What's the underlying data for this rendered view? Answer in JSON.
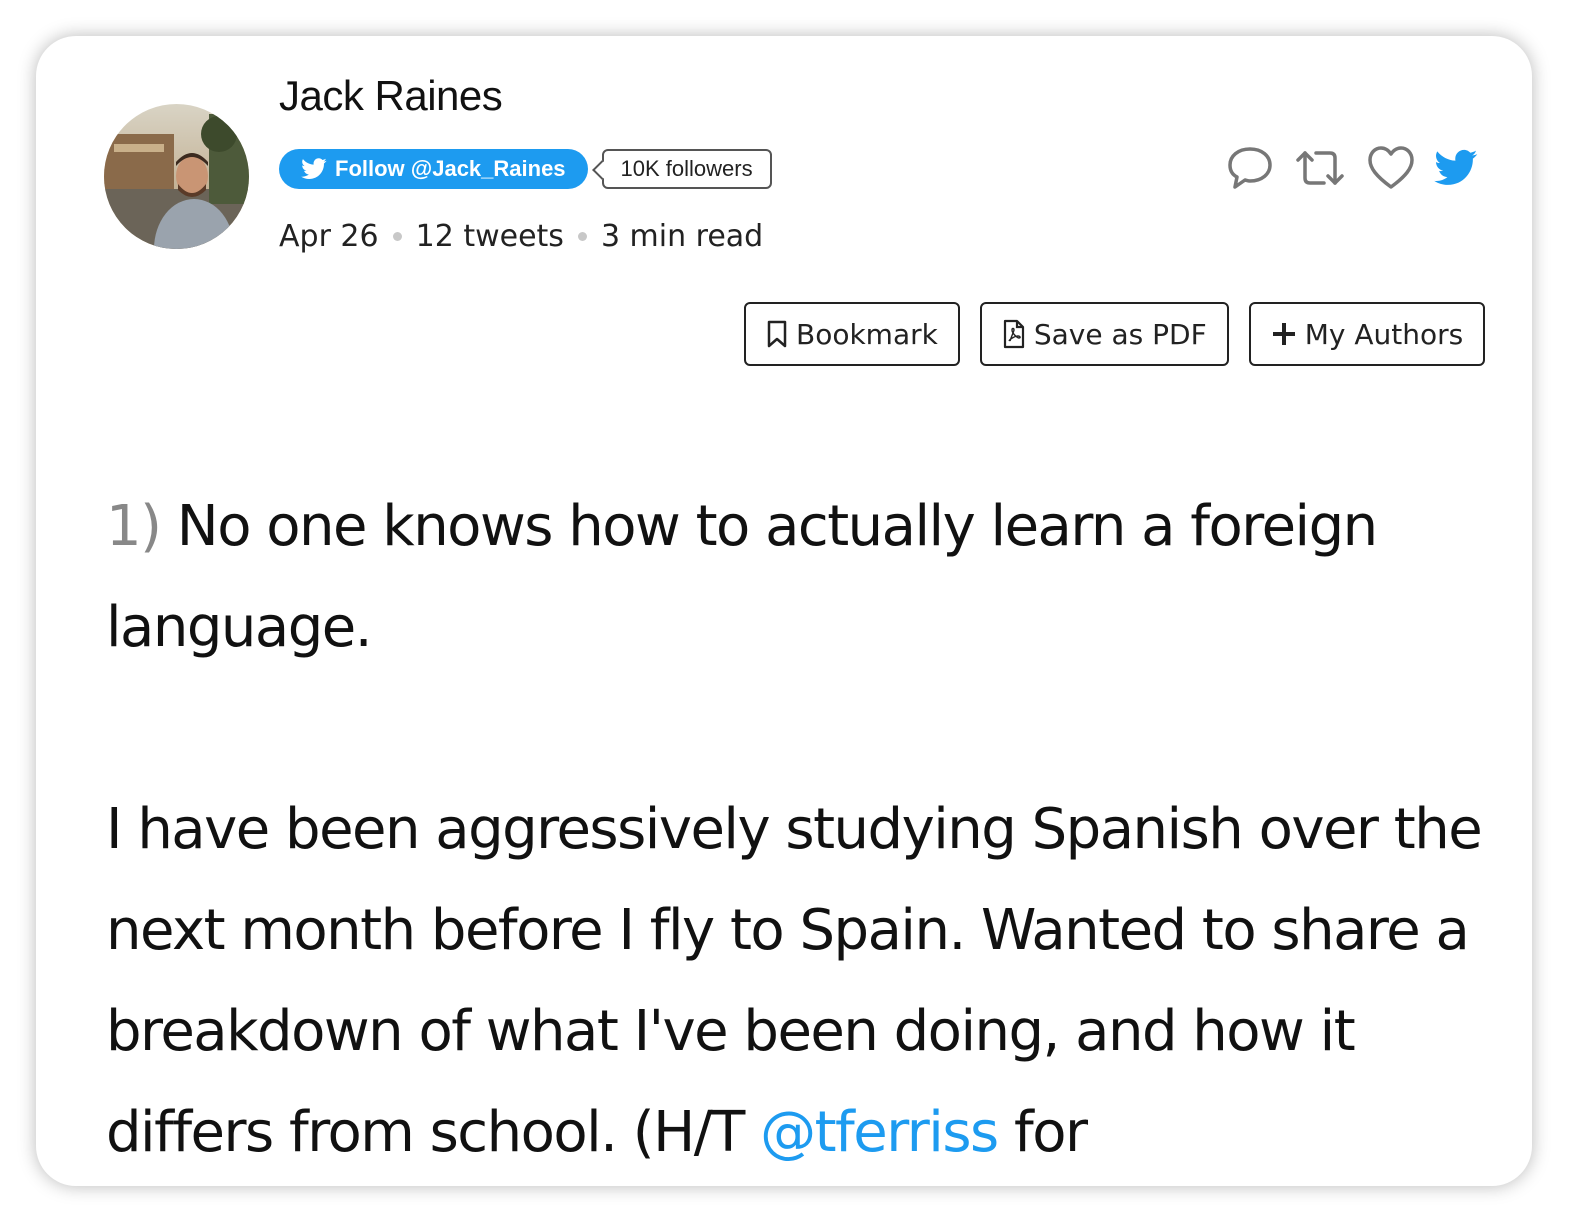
{
  "author": {
    "name": "Jack Raines",
    "follow_label": "Follow @Jack_Raines",
    "followers_label": "10K followers"
  },
  "meta": {
    "date": "Apr 26",
    "tweets": "12 tweets",
    "read_time": "3 min read"
  },
  "toolbar": {
    "bookmark_label": "Bookmark",
    "pdf_label": "Save as PDF",
    "authors_label": "My Authors"
  },
  "icons": {
    "reply": "speech-bubble-icon",
    "retweet": "retweet-icon",
    "like": "heart-icon",
    "twitter": "twitter-bird-icon"
  },
  "colors": {
    "brand_blue": "#1d9bf0",
    "number_gray": "#888888"
  },
  "tweet": {
    "number": "1)",
    "line1": "No one knows how to actually learn a foreign language.",
    "line2_before": "I have been aggressively studying Spanish over the next month before I fly to Spain. Wanted to share a breakdown of what I've been doing, and how it differs from school. (H/T ",
    "mention": "@tferriss",
    "line2_after": " for"
  }
}
